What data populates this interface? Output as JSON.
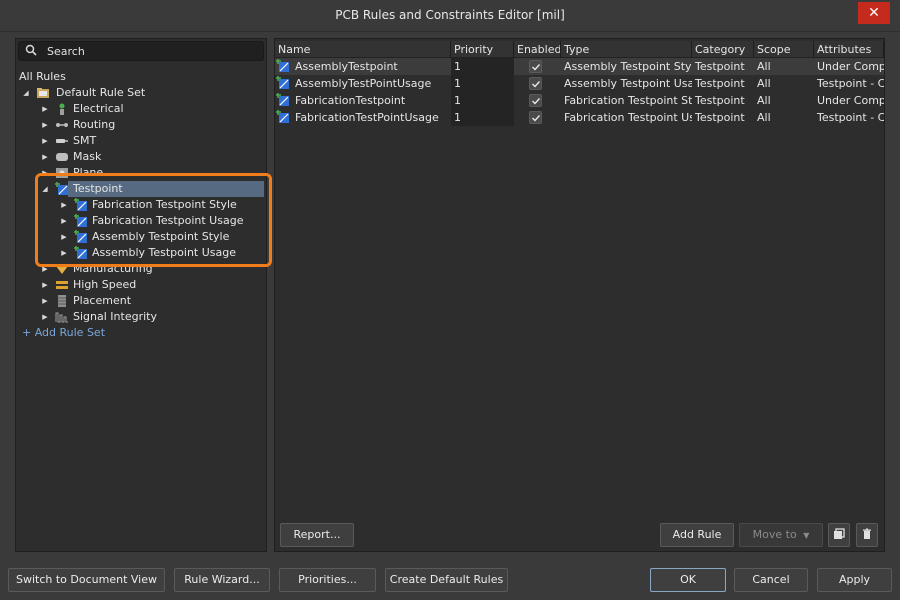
{
  "window": {
    "title": "PCB Rules and Constraints Editor [mil]"
  },
  "search": {
    "placeholder": "Search"
  },
  "tree": {
    "root": "All Rules",
    "rule_set": "Default Rule Set",
    "categories": [
      {
        "label": "Electrical",
        "icon": "electrical-icon"
      },
      {
        "label": "Routing",
        "icon": "routing-icon"
      },
      {
        "label": "SMT",
        "icon": "smt-icon"
      },
      {
        "label": "Mask",
        "icon": "mask-icon"
      },
      {
        "label": "Plane",
        "icon": "plane-icon"
      },
      {
        "label": "Testpoint",
        "icon": "testpoint-icon"
      },
      {
        "label": "Manufacturing",
        "icon": "manufacturing-icon"
      },
      {
        "label": "High Speed",
        "icon": "high-speed-icon"
      },
      {
        "label": "Placement",
        "icon": "placement-icon"
      },
      {
        "label": "Signal Integrity",
        "icon": "signal-integrity-icon"
      }
    ],
    "testpoint_children": [
      "Fabrication Testpoint Style",
      "Fabrication Testpoint Usage",
      "Assembly Testpoint Style",
      "Assembly Testpoint Usage"
    ],
    "add_rule_set": "+ Add Rule Set"
  },
  "grid": {
    "columns": [
      "Name",
      "Priority",
      "Enabled",
      "Type",
      "Category",
      "Scope",
      "Attributes"
    ],
    "rows": [
      {
        "name": "AssemblyTestpoint",
        "priority": "1",
        "enabled": true,
        "type": "Assembly Testpoint Style",
        "category": "Testpoint",
        "scope": "All",
        "attributes": "Under Comp"
      },
      {
        "name": "AssemblyTestPointUsage",
        "priority": "1",
        "enabled": true,
        "type": "Assembly Testpoint Usag",
        "category": "Testpoint",
        "scope": "All",
        "attributes": "Testpoint - C"
      },
      {
        "name": "FabricationTestpoint",
        "priority": "1",
        "enabled": true,
        "type": "Fabrication Testpoint Sty",
        "category": "Testpoint",
        "scope": "All",
        "attributes": "Under Comp"
      },
      {
        "name": "FabricationTestPointUsage",
        "priority": "1",
        "enabled": true,
        "type": "Fabrication Testpoint Us",
        "category": "Testpoint",
        "scope": "All",
        "attributes": "Testpoint - C"
      }
    ]
  },
  "panel_buttons": {
    "report": "Report...",
    "add_rule": "Add Rule",
    "move_to": "Move to"
  },
  "footer": {
    "switch_view": "Switch to Document View",
    "rule_wizard": "Rule Wizard...",
    "priorities": "Priorities...",
    "create_default": "Create Default Rules",
    "ok": "OK",
    "cancel": "Cancel",
    "apply": "Apply"
  },
  "colors": {
    "accent_selection": "#566a82",
    "highlight_outline": "#f07d1a",
    "close_red": "#c42b1c",
    "link_blue": "#7aa7d9"
  }
}
